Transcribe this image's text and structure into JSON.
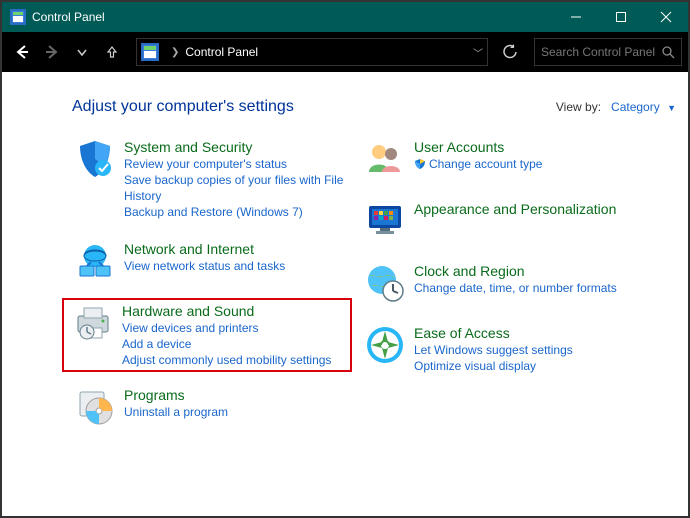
{
  "window": {
    "title": "Control Panel"
  },
  "address": {
    "location": "Control Panel"
  },
  "search": {
    "placeholder": "Search Control Panel"
  },
  "header": {
    "heading": "Adjust your computer's settings",
    "viewby_label": "View by:",
    "viewby_value": "Category"
  },
  "categories": {
    "system_security": {
      "title": "System and Security",
      "links": [
        "Review your computer's status",
        "Save backup copies of your files with File History",
        "Backup and Restore (Windows 7)"
      ]
    },
    "network": {
      "title": "Network and Internet",
      "links": [
        "View network status and tasks"
      ]
    },
    "hardware": {
      "title": "Hardware and Sound",
      "links": [
        "View devices and printers",
        "Add a device",
        "Adjust commonly used mobility settings"
      ]
    },
    "programs": {
      "title": "Programs",
      "links": [
        "Uninstall a program"
      ]
    },
    "users": {
      "title": "User Accounts",
      "links": [
        "Change account type"
      ]
    },
    "appearance": {
      "title": "Appearance and Personalization"
    },
    "clock": {
      "title": "Clock and Region",
      "links": [
        "Change date, time, or number formats"
      ]
    },
    "ease": {
      "title": "Ease of Access",
      "links": [
        "Let Windows suggest settings",
        "Optimize visual display"
      ]
    }
  }
}
